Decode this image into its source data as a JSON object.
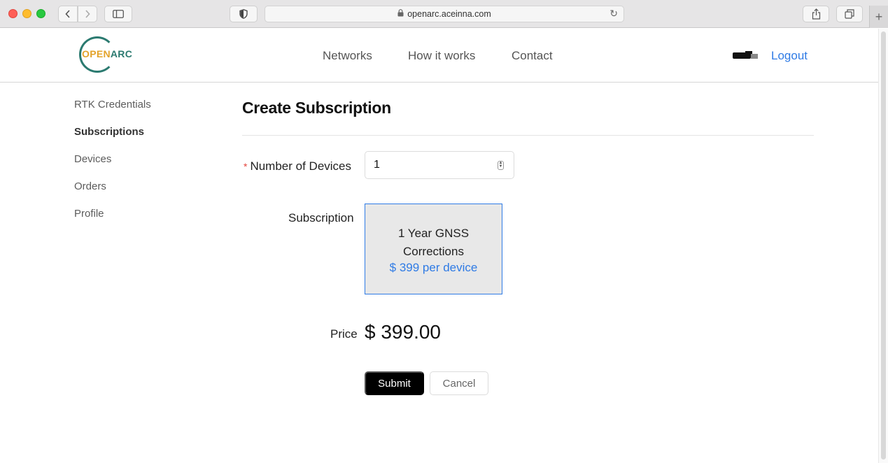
{
  "browser": {
    "url": "openarc.aceinna.com",
    "colors": {
      "close": "#fe5f57",
      "minimize": "#febc2e",
      "zoom": "#28c840"
    }
  },
  "header": {
    "logo": {
      "part1": "OPEN",
      "part2": "ARC"
    },
    "nav": [
      {
        "label": "Networks"
      },
      {
        "label": "How it works"
      },
      {
        "label": "Contact"
      }
    ],
    "logout_label": "Logout"
  },
  "sidebar": {
    "items": [
      {
        "label": "RTK Credentials",
        "active": false
      },
      {
        "label": "Subscriptions",
        "active": true
      },
      {
        "label": "Devices",
        "active": false
      },
      {
        "label": "Orders",
        "active": false
      },
      {
        "label": "Profile",
        "active": false
      }
    ]
  },
  "form": {
    "title": "Create Subscription",
    "required_mark": "*",
    "devices_label": "Number of Devices",
    "devices_value": "1",
    "subscription_label": "Subscription",
    "subscription_option": {
      "name_line1": "1 Year GNSS",
      "name_line2": "Corrections",
      "price": "$ 399 per device",
      "selected": true
    },
    "price_label": "Price",
    "price_value": "$ 399.00",
    "submit_label": "Submit",
    "cancel_label": "Cancel"
  },
  "colors": {
    "link": "#2f7be5",
    "brand_green": "#2b7a70",
    "brand_orange": "#e3a32a",
    "required": "#e5443d"
  }
}
